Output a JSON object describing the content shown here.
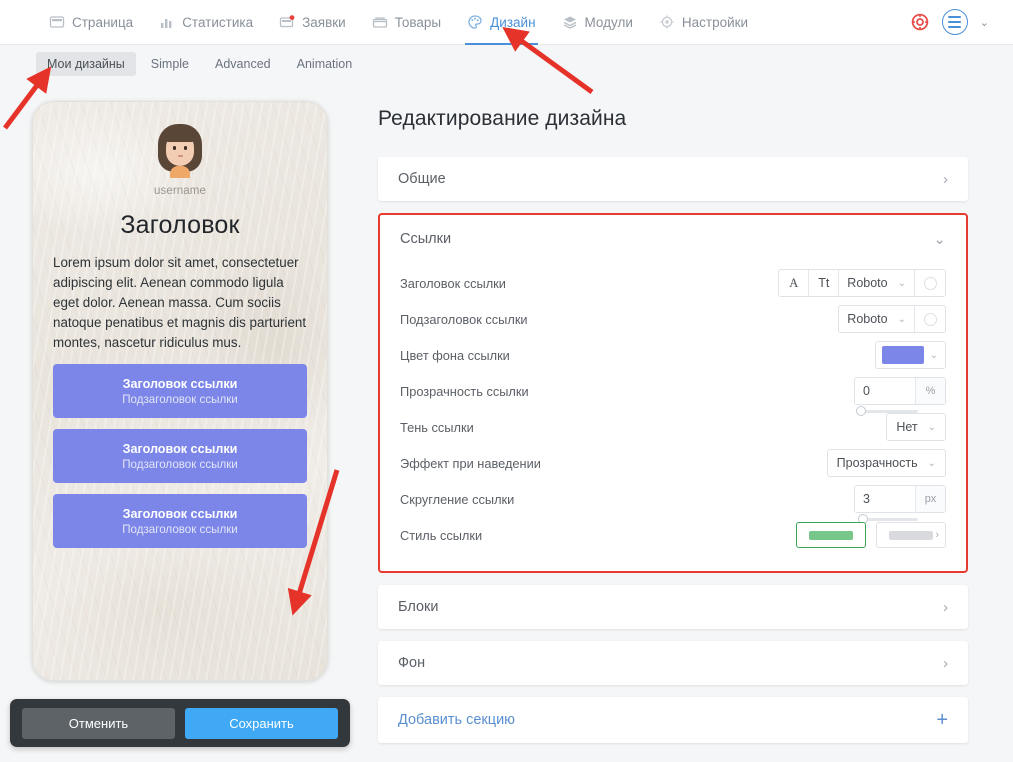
{
  "topnav": {
    "items": [
      {
        "label": "Страница",
        "icon": "page-icon",
        "active": false
      },
      {
        "label": "Статистика",
        "icon": "chart-icon",
        "active": false
      },
      {
        "label": "Заявки",
        "icon": "requests-icon",
        "active": false
      },
      {
        "label": "Товары",
        "icon": "products-icon",
        "active": false
      },
      {
        "label": "Дизайн",
        "icon": "palette-icon",
        "active": true
      },
      {
        "label": "Модули",
        "icon": "layers-icon",
        "active": false
      },
      {
        "label": "Настройки",
        "icon": "gear-icon",
        "active": false
      }
    ],
    "help_icon": "lifebuoy-icon",
    "menu_icon": "hamburger-circle-icon",
    "menu_chevron": "⌄"
  },
  "subtabs": [
    {
      "label": "Мои дизайны",
      "active": true
    },
    {
      "label": "Simple",
      "active": false
    },
    {
      "label": "Advanced",
      "active": false
    },
    {
      "label": "Animation",
      "active": false
    }
  ],
  "preview": {
    "username": "username",
    "title": "Заголовок",
    "body": "Lorem ipsum dolor sit amet, consectetuer adipiscing elit. Aenean commodo ligula eget dolor. Aenean massa. Cum sociis natoque penatibus et magnis dis parturient montes, nascetur ridiculus mus.",
    "link_bg_color": "#7b86e8",
    "links": [
      {
        "title": "Заголовок ссылки",
        "subtitle": "Подзаголовок ссылки"
      },
      {
        "title": "Заголовок ссылки",
        "subtitle": "Подзаголовок ссылки"
      },
      {
        "title": "Заголовок ссылки",
        "subtitle": "Подзаголовок ссылки"
      }
    ]
  },
  "savebar": {
    "cancel_label": "Отменить",
    "save_label": "Сохранить",
    "save_color": "#3fa9f5"
  },
  "panel": {
    "title": "Редактирование дизайна",
    "sections": {
      "obshie": {
        "label": "Общие",
        "chevron": "›"
      },
      "ssylki": {
        "label": "Ссылки",
        "chevron": "⌄"
      },
      "bloki": {
        "label": "Блоки",
        "chevron": "›"
      },
      "fon": {
        "label": "Фон",
        "chevron": "›"
      }
    },
    "highlight_color": "#e63b2e",
    "rows": {
      "link_title": {
        "label": "Заголовок ссылки",
        "color_btn": "A",
        "size_btn": "Tt",
        "font": "Roboto",
        "chevron": "⌄"
      },
      "link_subtitle": {
        "label": "Подзаголовок ссылки",
        "font": "Roboto",
        "chevron": "⌄"
      },
      "link_bg": {
        "label": "Цвет фона ссылки",
        "color": "#7b86e8",
        "chevron": "⌄"
      },
      "link_opacity": {
        "label": "Прозрачность ссылки",
        "value": "0",
        "unit": "%",
        "slider_percent": 0
      },
      "link_shadow": {
        "label": "Тень ссылки",
        "value": "Нет",
        "chevron": "⌄"
      },
      "hover_effect": {
        "label": "Эффект при наведении",
        "value": "Прозрачность",
        "chevron": "⌄"
      },
      "link_radius": {
        "label": "Скругление ссылки",
        "value": "3",
        "unit": "px",
        "slider_percent": 4
      },
      "link_style": {
        "label": "Стиль ссылки",
        "option_selected_color": "#78c78a",
        "option_other_color": "#d8dade",
        "arrow": "›"
      }
    },
    "add_section": {
      "label": "Добавить секцию",
      "plus": "+"
    }
  }
}
